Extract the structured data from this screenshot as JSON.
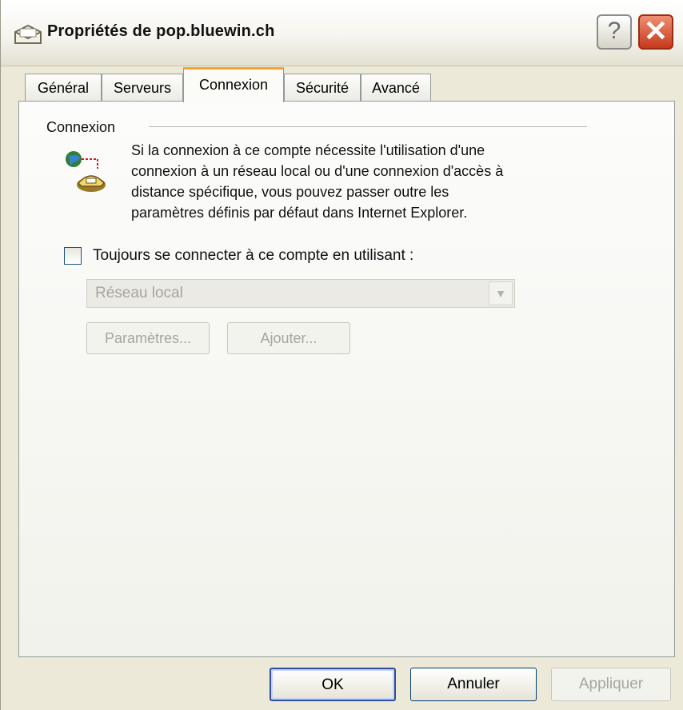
{
  "window": {
    "title": "Propriétés de pop.bluewin.ch",
    "help_symbol": "?",
    "close_symbol": "✕"
  },
  "tabs": [
    {
      "label": "Général",
      "active": false
    },
    {
      "label": "Serveurs",
      "active": false
    },
    {
      "label": "Connexion",
      "active": true
    },
    {
      "label": "Sécurité",
      "active": false
    },
    {
      "label": "Avancé",
      "active": false
    }
  ],
  "connexion": {
    "group_title": "Connexion",
    "description_lines": [
      "Si la connexion à ce compte nécessite l'utilisation d'une",
      "connexion à un réseau local ou d'une connexion d'accès à",
      "distance spécifique, vous pouvez passer outre les",
      "paramètres définis par défaut dans Internet Explorer."
    ],
    "always_connect_label": "Toujours se connecter à ce compte en utilisant :",
    "always_connect_checked": false,
    "connection_select_value": "Réseau local",
    "settings_button": "Paramètres...",
    "add_button": "Ajouter..."
  },
  "footer": {
    "ok": "OK",
    "cancel": "Annuler",
    "apply": "Appliquer"
  },
  "colors": {
    "active_tab_accent": "#f7a33a",
    "close_button": "#c5391a",
    "disabled_text": "#a6a6a0"
  }
}
